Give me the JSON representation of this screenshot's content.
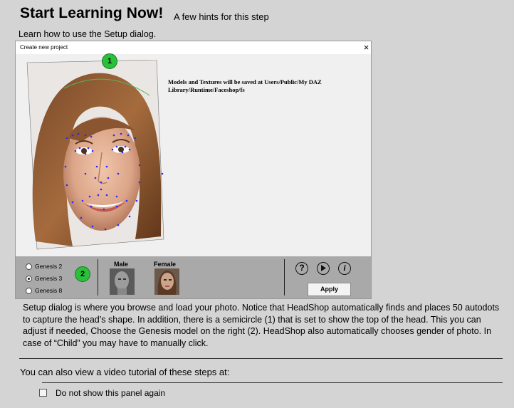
{
  "page": {
    "title": "Start Learning Now!",
    "subtitle": "A few hints for this step",
    "intro": "Learn how to use the Setup dialog."
  },
  "dialog": {
    "title": "Create new project",
    "close_label": "×",
    "model_note": "Models and Textures will be saved at Users/Public/My DAZ Library/Runtime/Faceshop/fs",
    "genesis_options": [
      {
        "label": "Genesis 2",
        "selected": false
      },
      {
        "label": "Genesis 3",
        "selected": true
      },
      {
        "label": "Genesis 8",
        "selected": false
      }
    ],
    "gender": {
      "male_label": "Male",
      "female_label": "Female"
    },
    "icons": {
      "help": "?",
      "info": "i"
    },
    "apply_label": "Apply"
  },
  "markers": {
    "one": "1",
    "two": "2"
  },
  "description": "Setup dialog is where you browse and load your photo. Notice that HeadShop automatically finds and places 50 autodots to capture the head’s shape. In addition, there is a semicircle (1) that is set to show the top of the head. This you can adjust if needed, Choose the Genesis model on the right (2). HeadShop also automatically chooses gender of photo. In case of “Child” you may have to manually click.",
  "video_line": "You can also view a video tutorial of these steps at:",
  "checkbox": {
    "label": "Do not show this panel again",
    "checked": false
  },
  "colors": {
    "background": "#d4d4d4",
    "panel": "#a9a9a9",
    "marker_green": "#2ac03a",
    "autodot_blue": "#2a2aff"
  }
}
